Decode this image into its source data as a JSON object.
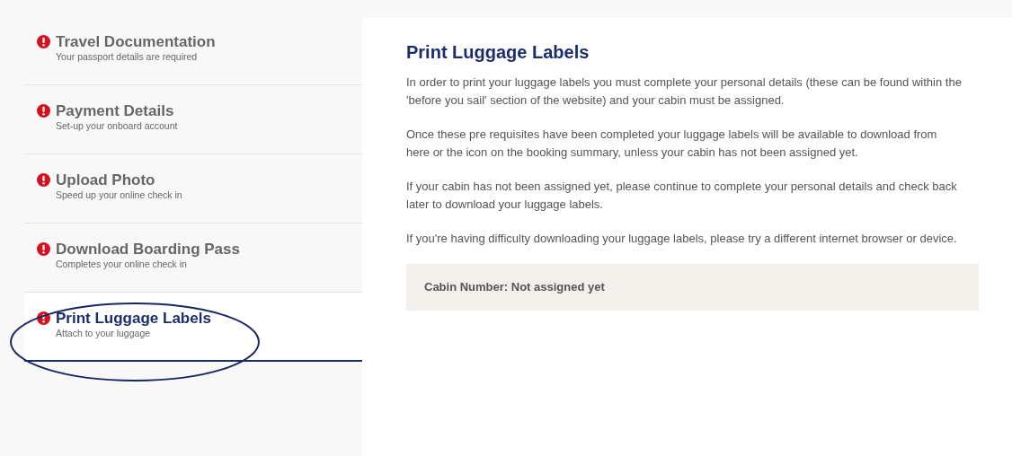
{
  "steps": [
    {
      "title": "Travel Documentation",
      "subtitle": "Your passport details are required",
      "selected": false
    },
    {
      "title": "Payment Details",
      "subtitle": "Set-up your onboard account",
      "selected": false
    },
    {
      "title": "Upload Photo",
      "subtitle": "Speed up your online check in",
      "selected": false
    },
    {
      "title": "Download Boarding Pass",
      "subtitle": "Completes your online check in",
      "selected": false
    },
    {
      "title": "Print Luggage Labels",
      "subtitle": "Attach to your luggage",
      "selected": true
    }
  ],
  "panel": {
    "heading": "Print Luggage Labels",
    "paragraphs": [
      "In order to print your luggage labels you must complete your personal details (these can be found within the 'before you sail' section of the website) and your cabin must be assigned.",
      "Once these pre requisites have been completed your luggage labels will be available to download from here or the icon on the booking summary, unless your cabin has not been assigned yet.",
      "If your cabin has not been assigned yet, please continue to complete your personal details and check back later to download your luggage labels.",
      "If you're having difficulty downloading your luggage labels, please try a different internet browser or device."
    ],
    "cabin_status": "Cabin Number: Not assigned yet"
  }
}
